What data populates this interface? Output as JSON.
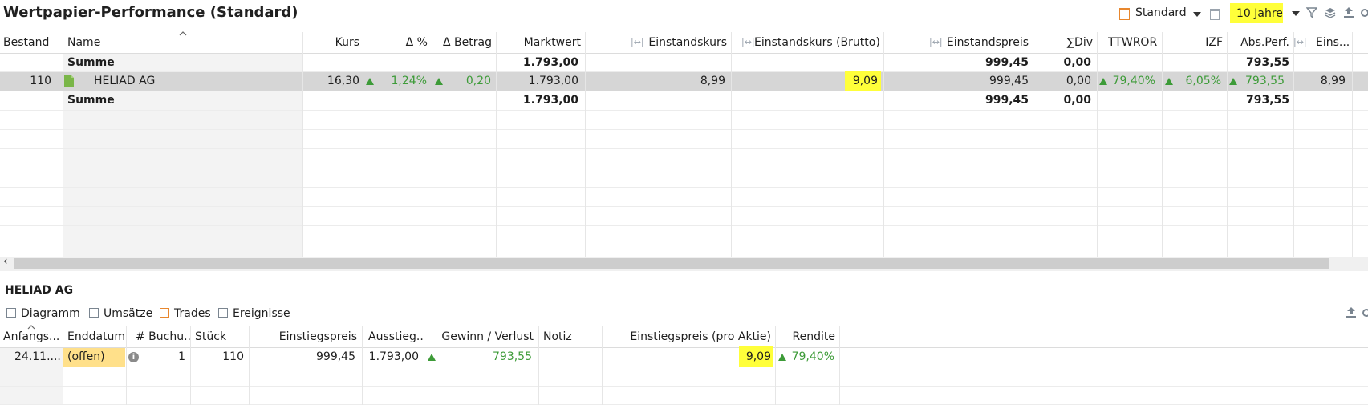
{
  "title": "Wertpapier-Performance (Standard)",
  "toolbar": {
    "view_label": "Standard",
    "period_label": "10 Jahre"
  },
  "table": {
    "headers": {
      "bestand": "Bestand",
      "name": "Name",
      "kurs": "Kurs",
      "delta_pct": "Δ %",
      "delta_betrag": "Δ Betrag",
      "marktwert": "Marktwert",
      "einstandskurs": "Einstandskurs",
      "einstandskurs_brutto": "Einstandskurs (Brutto)",
      "einstandspreis": "Einstandspreis",
      "div": "∑Div",
      "ttwror": "TTWROR",
      "izf": "IZF",
      "absperf": "Abs.Perf.",
      "eins": "Eins..."
    },
    "summe_top": {
      "name": "Summe",
      "marktwert": "1.793,00",
      "einstandspreis": "999,45",
      "div": "0,00",
      "absperf": "793,55"
    },
    "row": {
      "bestand": "110",
      "name": "HELIAD AG",
      "kurs": "16,30",
      "delta_pct": "1,24%",
      "delta_betrag": "0,20",
      "marktwert": "1.793,00",
      "einstandskurs": "8,99",
      "einstandskurs_brutto": "9,09",
      "einstandspreis": "999,45",
      "div": "0,00",
      "ttwror": "79,40%",
      "izf": "6,05%",
      "absperf": "793,55",
      "eins": "8,99"
    },
    "summe_bottom": {
      "name": "Summe",
      "marktwert": "1.793,00",
      "einstandspreis": "999,45",
      "div": "0,00",
      "absperf": "793,55"
    }
  },
  "detail": {
    "title": "HELIAD AG",
    "tabs": [
      "Diagramm",
      "Umsätze",
      "Trades",
      "Ereignisse"
    ],
    "headers": {
      "anfang": "Anfangs...",
      "enddatum": "Enddatum",
      "buchungen": "# Buchu...",
      "stueck": "Stück",
      "einstiegspreis": "Einstiegspreis",
      "ausstieg": "Ausstieg...",
      "gewinn": "Gewinn / Verlust",
      "notiz": "Notiz",
      "einstiegspreis_pro_aktie": "Einstiegspreis (pro Aktie)",
      "rendite": "Rendite"
    },
    "row": {
      "anfang": "24.11....",
      "enddatum": "(offen)",
      "buchungen": "1",
      "stueck": "110",
      "einstiegspreis": "999,45",
      "ausstieg": "1.793,00",
      "gewinn": "793,55",
      "einstiegspreis_pro_aktie": "9,09",
      "rendite": "79,40%"
    }
  },
  "colors": {
    "highlight": "#ffff3a",
    "positive": "#3d9b38",
    "offen_bg": "#ffe08a",
    "accent_orange": "#e8872e"
  },
  "icons": [
    "calendar-icon",
    "dropdown-icon",
    "filter-icon",
    "layers-icon",
    "export-icon",
    "resize-column-icon",
    "info-icon",
    "document-icon",
    "scroll-left-icon"
  ]
}
